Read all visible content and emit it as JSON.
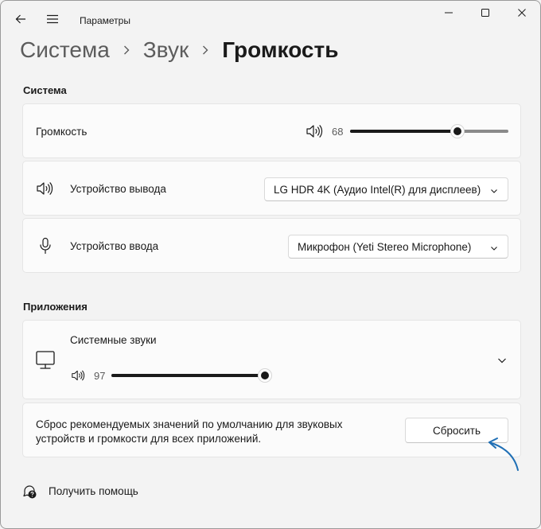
{
  "window": {
    "title": "Параметры"
  },
  "breadcrumb": {
    "items": [
      "Система",
      "Звук"
    ],
    "current": "Громкость"
  },
  "system": {
    "section_title": "Система",
    "volume": {
      "label": "Громкость",
      "value": 68,
      "value_text": "68",
      "level": 0.68
    },
    "output": {
      "label": "Устройство вывода",
      "selected": "LG HDR 4K (Аудио Intel(R) для дисплеев)"
    },
    "input": {
      "label": "Устройство ввода",
      "selected": "Микрофон (Yeti Stereo Microphone)"
    }
  },
  "apps": {
    "section_title": "Приложения",
    "system_sounds": {
      "label": "Системные звуки",
      "value": 97,
      "value_text": "97",
      "level": 0.97
    },
    "reset": {
      "description_line1": "Сброс рекомендуемых значений по умолчанию для звуковых",
      "description_line2": "устройств и громкости для всех приложений.",
      "button_label": "Сбросить"
    }
  },
  "help": {
    "label": "Получить помощь"
  },
  "icons": {
    "back": "back-arrow-icon",
    "menu": "hamburger-menu-icon",
    "minimize": "minimize-icon",
    "maximize": "maximize-icon",
    "close": "close-icon",
    "speaker": "speaker-icon",
    "microphone": "microphone-icon",
    "monitor": "monitor-icon",
    "chevron": "chevron-down-icon",
    "help": "help-chat-icon",
    "annotation": "annotation-arrow"
  },
  "colors": {
    "accent_annotation": "#1f6fb5",
    "slider_fill": "#1a1a1a",
    "background": "#f3f3f3"
  }
}
